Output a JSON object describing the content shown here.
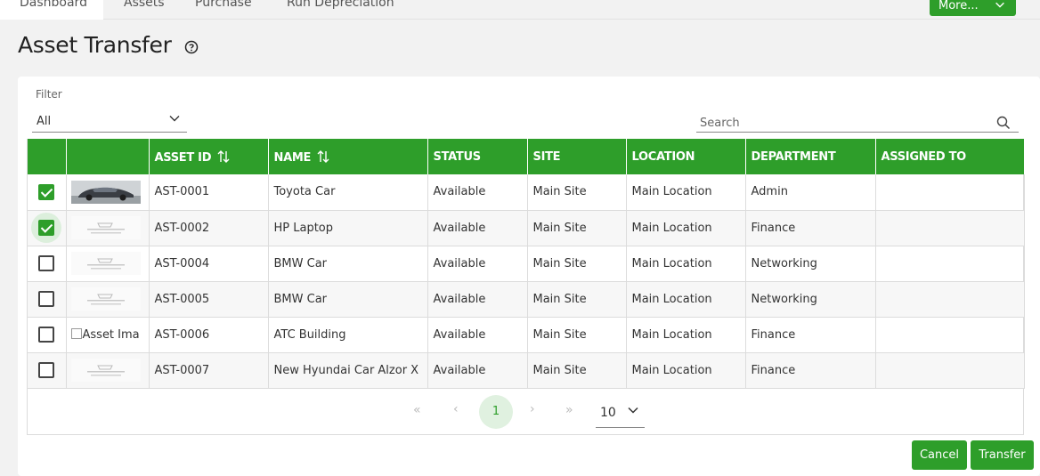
{
  "nav": {
    "tabs": [
      "Dashboard",
      "Assets",
      "Purchase",
      "Run Depreciation"
    ],
    "more_label": "More..."
  },
  "page": {
    "title": "Asset Transfer"
  },
  "filter": {
    "label": "Filter",
    "value": "All"
  },
  "search": {
    "placeholder": "Search"
  },
  "table": {
    "headers": [
      "ASSET ID",
      "NAME",
      "STATUS",
      "SITE",
      "LOCATION",
      "DEPARTMENT",
      "ASSIGNED TO"
    ],
    "rows": [
      {
        "checked": true,
        "image": "car-photo",
        "id": "AST-0001",
        "name": "Toyota Car",
        "status": "Available",
        "site": "Main Site",
        "location": "Main Location",
        "department": "Admin",
        "assigned": ""
      },
      {
        "checked": true,
        "image": "placeholder-logo",
        "id": "AST-0002",
        "name": "HP Laptop",
        "status": "Available",
        "site": "Main Site",
        "location": "Main Location",
        "department": "Finance",
        "assigned": ""
      },
      {
        "checked": false,
        "image": "placeholder-logo",
        "id": "AST-0004",
        "name": "BMW Car",
        "status": "Available",
        "site": "Main Site",
        "location": "Main Location",
        "department": "Networking",
        "assigned": ""
      },
      {
        "checked": false,
        "image": "placeholder-logo",
        "id": "AST-0005",
        "name": "BMW Car",
        "status": "Available",
        "site": "Main Site",
        "location": "Main Location",
        "department": "Networking",
        "assigned": ""
      },
      {
        "checked": false,
        "image": "broken",
        "id": "AST-0006",
        "name": "ATC Building",
        "status": "Available",
        "site": "Main Site",
        "location": "Main Location",
        "department": "Finance",
        "assigned": ""
      },
      {
        "checked": false,
        "image": "placeholder-logo",
        "id": "AST-0007",
        "name": "New Hyundai Car Alzor X",
        "status": "Available",
        "site": "Main Site",
        "location": "Main Location",
        "department": "Finance",
        "assigned": ""
      }
    ],
    "broken_image_alt": "Asset Ima"
  },
  "pagination": {
    "first": "«",
    "prev": "‹",
    "current": "1",
    "next": "›",
    "last": "»",
    "page_size": "10"
  },
  "actions": {
    "cancel": "Cancel",
    "transfer": "Transfer"
  },
  "colors": {
    "accent": "#2e9e2a"
  }
}
